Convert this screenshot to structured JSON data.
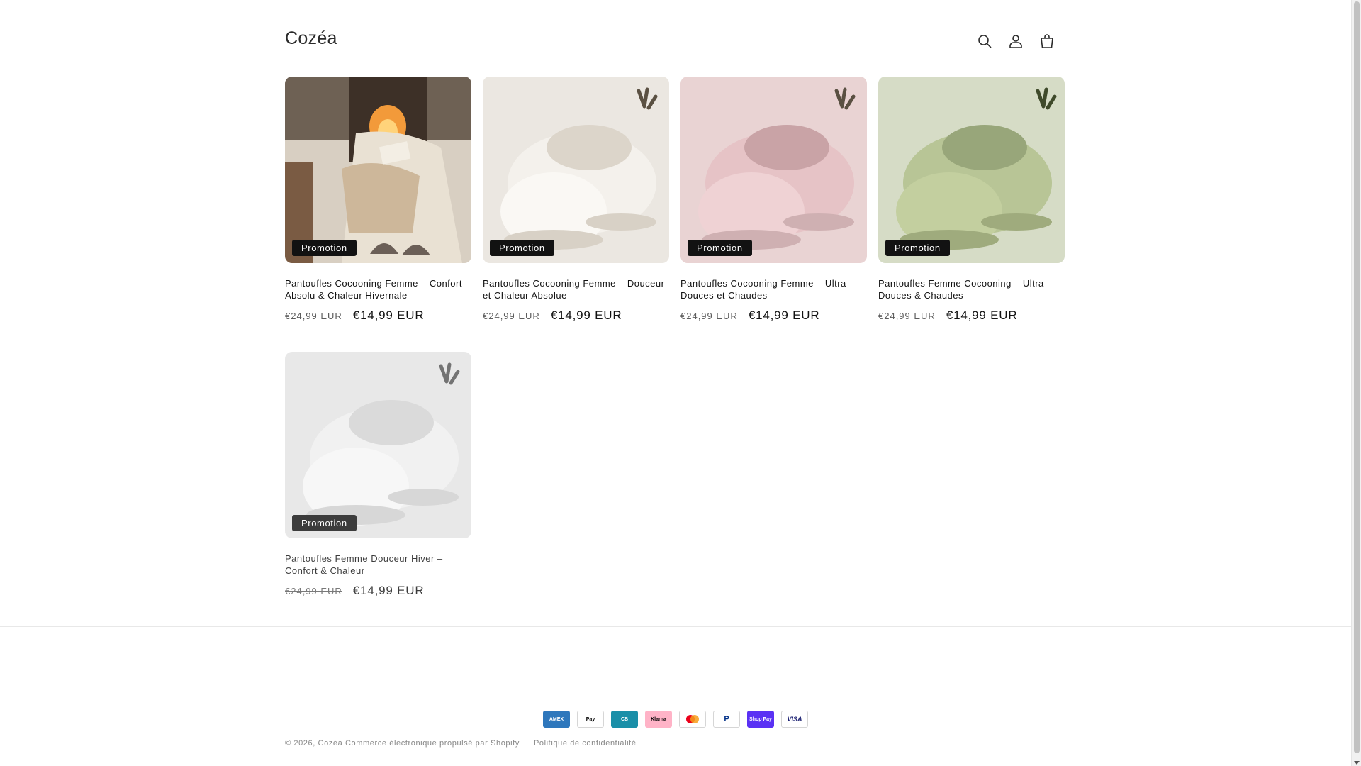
{
  "header": {
    "logo": "Cozéa",
    "icons": [
      "search-icon",
      "account-icon",
      "cart-icon"
    ]
  },
  "products": [
    {
      "title": "Pantoufles Cocooning Femme – Confort Absolu & Chaleur Hivernale",
      "badge": "Promotion",
      "price_old": "€24,99 EUR",
      "price_new": "€14,99 EUR"
    },
    {
      "title": "Pantoufles Cocooning Femme – Douceur et Chaleur Absolue",
      "badge": "Promotion",
      "price_old": "€24,99 EUR",
      "price_new": "€14,99 EUR"
    },
    {
      "title": "Pantoufles Cocooning Femme – Ultra Douces et Chaudes",
      "badge": "Promotion",
      "price_old": "€24,99 EUR",
      "price_new": "€14,99 EUR"
    },
    {
      "title": "Pantoufles Femme Cocooning – Ultra Douces & Chaudes",
      "badge": "Promotion",
      "price_old": "€24,99 EUR",
      "price_new": "€14,99 EUR"
    },
    {
      "title": "Pantoufles Femme Douceur Hiver – Confort & Chaleur",
      "badge": "Promotion",
      "price_old": "€24,99 EUR",
      "price_new": "€14,99 EUR"
    }
  ],
  "footer": {
    "payments": [
      {
        "name": "American Express",
        "label": "AMEX",
        "color": "#2e77bc"
      },
      {
        "name": "Apple Pay",
        "label": "Pay",
        "color": "#ffffff"
      },
      {
        "name": "Cartes Bancaires",
        "label": "CB",
        "color": "#1a8fa8"
      },
      {
        "name": "Klarna",
        "label": "Klarna",
        "color": "#ffb3c7"
      },
      {
        "name": "Mastercard",
        "label": "",
        "color": "#ffffff"
      },
      {
        "name": "PayPal",
        "label": "P",
        "color": "#ffffff"
      },
      {
        "name": "Shop Pay",
        "label": "Shop Pay",
        "color": "#5a31f4"
      },
      {
        "name": "Visa",
        "label": "VISA",
        "color": "#ffffff"
      }
    ],
    "copyright": "© 2026,",
    "store_link": "Cozéa",
    "powered": "Commerce électronique propulsé par Shopify",
    "policy": "Politique de confidentialité"
  },
  "colors": {
    "badge_bg": "#121212",
    "text": "#121212",
    "muted": "#5c5c5c"
  }
}
